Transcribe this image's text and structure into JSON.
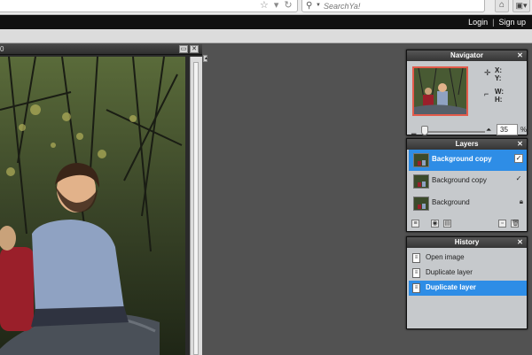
{
  "browser": {
    "search_placeholder": "SearchYa!",
    "star_icon": "star-icon",
    "reload_icon": "reload-icon",
    "home_icon": "home-icon"
  },
  "header": {
    "login": "Login",
    "separator": "|",
    "signup": "Sign up"
  },
  "image_window": {
    "title": "0",
    "min_icon": "window-minimize-icon",
    "close_icon": "window-close-icon"
  },
  "navigator": {
    "title": "Navigator",
    "x_label": "X:",
    "y_label": "Y:",
    "w_label": "W:",
    "h_label": "H:",
    "zoom": "35",
    "zoom_unit": "%"
  },
  "layers": {
    "title": "Layers",
    "items": [
      {
        "name": "Background copy",
        "selected": true,
        "visible": true
      },
      {
        "name": "Background copy",
        "selected": false,
        "visible": true
      },
      {
        "name": "Background",
        "selected": false,
        "locked": true
      }
    ]
  },
  "history": {
    "title": "History",
    "items": [
      {
        "label": "Open image",
        "selected": false
      },
      {
        "label": "Duplicate layer",
        "selected": false
      },
      {
        "label": "Duplicate layer",
        "selected": true
      }
    ]
  },
  "colors": {
    "selection_blue": "#2e8de6",
    "workspace": "#525252",
    "panel_bg": "#c6c9cc",
    "navigator_frame": "#e35b4b"
  }
}
